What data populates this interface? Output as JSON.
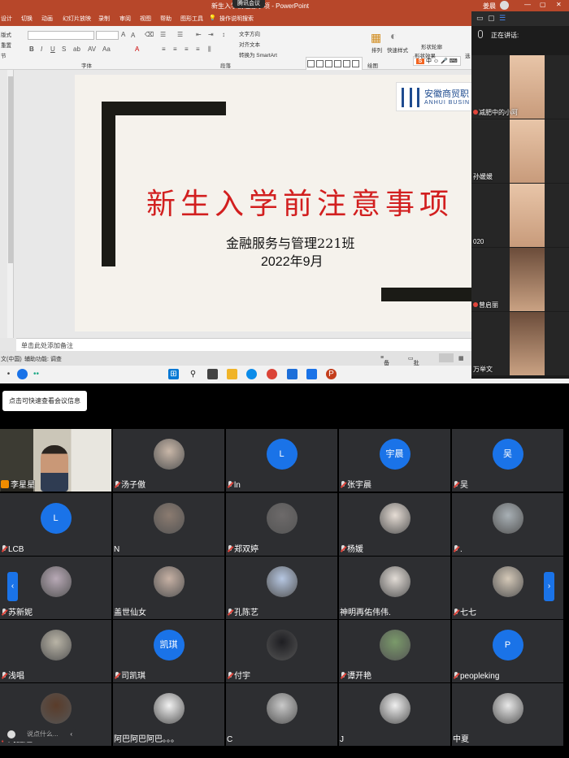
{
  "ppt": {
    "window_title": "新生入学前注意事项 - PowerPoint",
    "meeting_badge": "腾讯会议",
    "user_name": "姜晨",
    "window_buttons": [
      "—",
      "▢",
      "✕"
    ],
    "tabs": [
      "设计",
      "切换",
      "动画",
      "幻灯片放映",
      "录制",
      "审阅",
      "视图",
      "帮助",
      "图形工具",
      "操作说明搜索"
    ],
    "ribbon": {
      "left_labels": [
        "版式",
        "重置",
        "节"
      ],
      "text_direction": "文字方向",
      "align_text": "对齐文本",
      "smartart": "转换为 SmartArt",
      "arrange": "排列",
      "quick_styles": "快速样式",
      "shape_outline": "形状轮廓",
      "shape_effects": "形状效果",
      "select": "选",
      "ime": "中",
      "group_font": "字体",
      "group_paragraph": "段落",
      "group_drawing": "绘图"
    },
    "slide": {
      "logo_cn": "安徽商贸职",
      "logo_en": "ANHUI BUSIN",
      "title": "新生入学前注意事项",
      "subtitle1": "金融服务与管理221班",
      "subtitle2": "2022年9月"
    },
    "notes_placeholder": "单击此处添加备注",
    "status": {
      "lang": "文(中国)",
      "accessibility": "辅助功能: 调查",
      "notes": "备注",
      "comments": "批注"
    }
  },
  "speaker_panel": {
    "speaking_label": "正在讲话:",
    "speakers": [
      {
        "name": "减肥中的小阿"
      },
      {
        "name": "孙媛媛"
      },
      {
        "name": "020"
      },
      {
        "name": "曾启丽"
      },
      {
        "name": "万举文"
      }
    ]
  },
  "meeting": {
    "hint": "点击可快速查看会议信息",
    "chat_placeholder": "说点什么...",
    "participants": [
      {
        "name": "李星星",
        "avatar": "video",
        "muted": false
      },
      {
        "name": "汤子傲",
        "avatar": "photo",
        "muted": true,
        "color": "#c9b7a8"
      },
      {
        "name": "ln",
        "avatar": "letter",
        "letter": "L",
        "muted": true
      },
      {
        "name": "张宇晨",
        "avatar": "letter",
        "letter": "宇晨",
        "muted": true
      },
      {
        "name": "吴",
        "avatar": "letter",
        "letter": "吴",
        "muted": true
      },
      {
        "name": "LCB",
        "avatar": "letter",
        "letter": "L",
        "muted": true
      },
      {
        "name": "N",
        "avatar": "photo",
        "muted": false,
        "color": "#8b7b70"
      },
      {
        "name": "郑双婷",
        "avatar": "photo",
        "muted": true,
        "color": "#6d6a6a"
      },
      {
        "name": "杨媛",
        "avatar": "photo",
        "muted": true,
        "color": "#e6ddd5"
      },
      {
        "name": ".",
        "avatar": "photo",
        "muted": true,
        "color": "#a8b0b5"
      },
      {
        "name": "苏新妮",
        "avatar": "photo",
        "muted": true,
        "color": "#b8a9b6"
      },
      {
        "name": "盖世仙女",
        "avatar": "photo",
        "muted": false,
        "color": "#c7b1a4"
      },
      {
        "name": "孔陈艺",
        "avatar": "photo",
        "muted": true,
        "color": "#b6c7e2"
      },
      {
        "name": "神明再佑伟伟.",
        "avatar": "photo",
        "muted": false,
        "color": "#e2dcd6"
      },
      {
        "name": "七七",
        "avatar": "photo",
        "muted": true,
        "color": "#d5c9b8"
      },
      {
        "name": "浅唱",
        "avatar": "photo",
        "muted": true,
        "color": "#b9b4a6"
      },
      {
        "name": "司凯琪",
        "avatar": "letter",
        "letter": "凯琪",
        "muted": true
      },
      {
        "name": "付宇",
        "avatar": "photo",
        "muted": true,
        "color": "#1e1e22"
      },
      {
        "name": "谭开艳",
        "avatar": "photo",
        "muted": true,
        "color": "#7a9a6a"
      },
      {
        "name": "peopleking",
        "avatar": "letter",
        "letter": "P",
        "muted": true
      },
      {
        "name": "刘鑫越",
        "avatar": "photo",
        "muted": true,
        "color": "#5a3c2a"
      },
      {
        "name": "阿巴阿巴阿巴。。。",
        "avatar": "photo",
        "muted": false,
        "color": "#f2f2f2"
      },
      {
        "name": "C",
        "avatar": "photo",
        "muted": false,
        "color": "#c9c9c9"
      },
      {
        "name": "J",
        "avatar": "photo",
        "muted": false,
        "color": "#efefef"
      },
      {
        "name": "中夏",
        "avatar": "photo",
        "muted": false,
        "color": "#e8e8e8"
      }
    ]
  },
  "colors": {
    "ppt_accent": "#b7472a",
    "slide_title": "#d21f1f",
    "meeting_blue": "#1a73e8",
    "tile_bg": "#2d2e31"
  }
}
